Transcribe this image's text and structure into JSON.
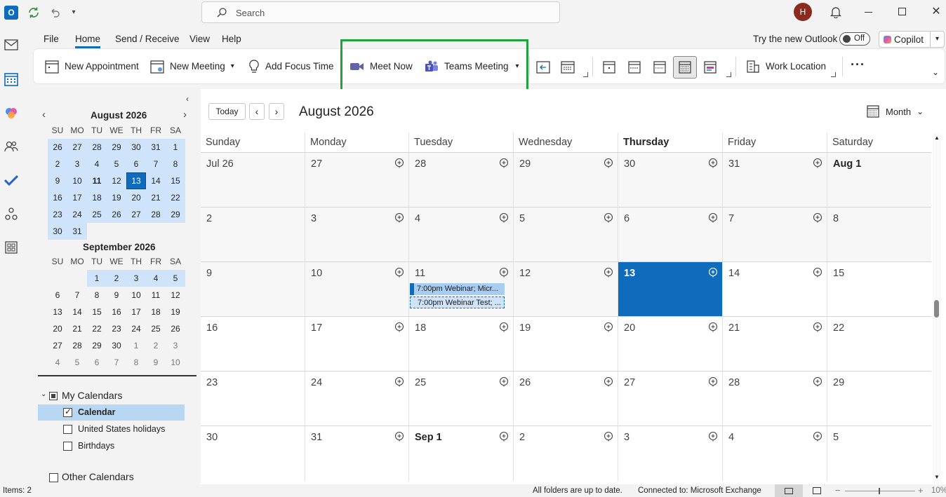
{
  "titlebar": {
    "search_placeholder": "Search",
    "avatar_initial": "H"
  },
  "menu": {
    "file": "File",
    "home": "Home",
    "send_receive": "Send / Receive",
    "view": "View",
    "help": "Help",
    "try_new": "Try the new Outlook",
    "toggle_state": "Off",
    "copilot": "Copilot"
  },
  "ribbon": {
    "new_appointment": "New Appointment",
    "new_meeting": "New Meeting",
    "focus_time": "Add Focus Time",
    "meet_now": "Meet Now",
    "teams_meeting": "Teams Meeting",
    "work_location": "Work Location",
    "more": "···"
  },
  "navpane": {
    "aug_title": "August 2026",
    "sep_title": "September 2026",
    "weekdays": [
      "SU",
      "MO",
      "TU",
      "WE",
      "TH",
      "FR",
      "SA"
    ],
    "aug_days": [
      "26",
      "27",
      "28",
      "29",
      "30",
      "31",
      "1",
      "2",
      "3",
      "4",
      "5",
      "6",
      "7",
      "8",
      "9",
      "10",
      "11",
      "12",
      "13",
      "14",
      "15",
      "16",
      "17",
      "18",
      "19",
      "20",
      "21",
      "22",
      "23",
      "24",
      "25",
      "26",
      "27",
      "28",
      "29",
      "30",
      "31"
    ],
    "sep_days": [
      "",
      "",
      "1",
      "2",
      "3",
      "4",
      "5",
      "6",
      "7",
      "8",
      "9",
      "10",
      "11",
      "12",
      "13",
      "14",
      "15",
      "16",
      "17",
      "18",
      "19",
      "20",
      "21",
      "22",
      "23",
      "24",
      "25",
      "26",
      "27",
      "28",
      "29",
      "30",
      "1",
      "2",
      "3",
      "4",
      "5",
      "6",
      "7",
      "8",
      "9",
      "10"
    ],
    "my_calendars": "My Calendars",
    "calendars": [
      "Calendar",
      "United States holidays",
      "Birthdays"
    ],
    "other_calendars": "Other Calendars"
  },
  "main": {
    "today_btn": "Today",
    "month_title": "August 2026",
    "view_label": "Month",
    "day_headers": [
      "Sunday",
      "Monday",
      "Tuesday",
      "Wednesday",
      "Thursday",
      "Friday",
      "Saturday"
    ],
    "weeks": [
      [
        "Jul 26",
        "27",
        "28",
        "29",
        "30",
        "31",
        "Aug 1"
      ],
      [
        "2",
        "3",
        "4",
        "5",
        "6",
        "7",
        "8"
      ],
      [
        "9",
        "10",
        "11",
        "12",
        "13",
        "14",
        "15"
      ],
      [
        "16",
        "17",
        "18",
        "19",
        "20",
        "21",
        "22"
      ],
      [
        "23",
        "24",
        "25",
        "26",
        "27",
        "28",
        "29"
      ],
      [
        "30",
        "31",
        "Sep 1",
        "2",
        "3",
        "4",
        "5"
      ]
    ],
    "events": [
      "7:00pm Webinar; Micr...",
      "7:00pm Webinar Test; ..."
    ]
  },
  "status": {
    "items": "Items: 2",
    "sync": "All folders are up to date.",
    "connection": "Connected to: Microsoft Exchange",
    "zoom": "10%"
  },
  "colors": {
    "accent": "#0f6cbd",
    "highlight_box": "#21a33b",
    "selection": "#cfe4fa"
  }
}
